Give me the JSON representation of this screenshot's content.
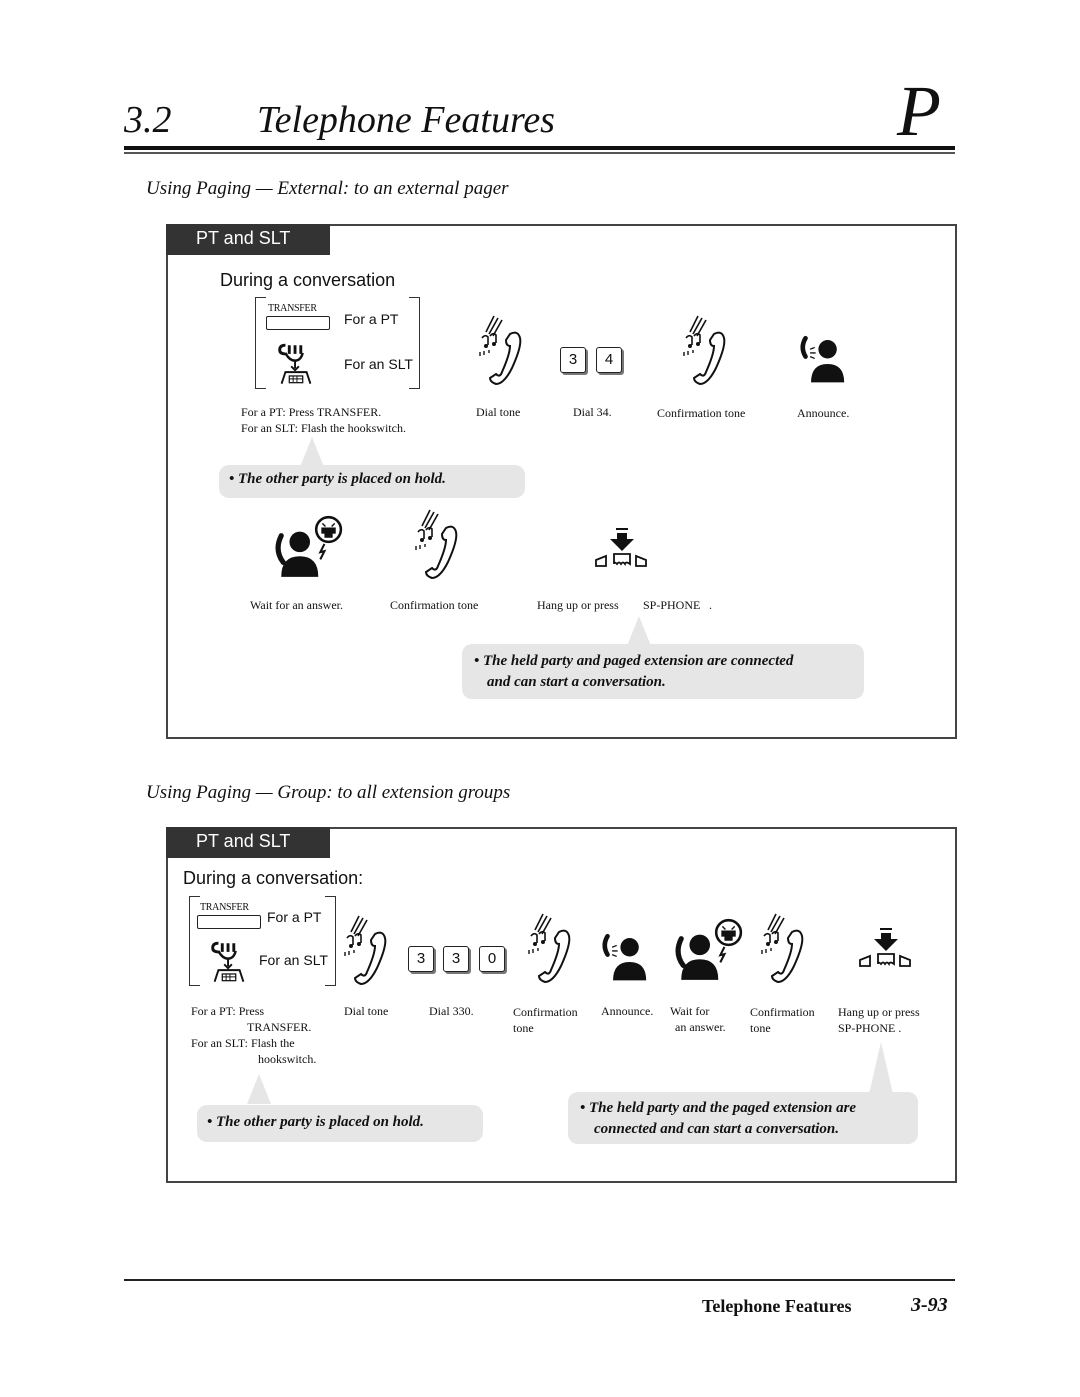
{
  "header": {
    "section_number": "3.2",
    "section_title": "Telephone Features",
    "tab_letter": "P"
  },
  "external": {
    "title": "Using Paging — External: to an external pager",
    "tab_label": "PT and SLT",
    "heading": "During a conversation",
    "transfer_button_label": "TRANSFER",
    "for_pt": "For a PT",
    "for_slt": "For an SLT",
    "step_captions": {
      "transfer_line1": "For a PT: Press TRANSFER.",
      "transfer_line2": "For an SLT: Flash the hookswitch.",
      "dial_tone": "Dial tone",
      "dial": "Dial 34.",
      "confirmation": "Confirmation tone",
      "announce": "Announce.",
      "wait": "Wait for an answer.",
      "confirmation2": "Confirmation tone",
      "hangup": "Hang up or press",
      "sp_phone": "SP-PHONE",
      "period": "."
    },
    "keys": [
      "3",
      "4"
    ],
    "note_hold": "The other party is placed on hold.",
    "note_connected_line1": "The held party and paged extension are connected",
    "note_connected_line2": "and can start a conversation."
  },
  "group": {
    "title": "Using Paging — Group: to all extension groups",
    "tab_label": "PT and SLT",
    "heading": "During a conversation:",
    "transfer_button_label": "TRANSFER",
    "for_pt": "For a PT",
    "for_slt": "For an SLT",
    "captions": {
      "transfer_l1": "For a PT: Press",
      "transfer_l2": "TRANSFER.",
      "transfer_l3": "For an SLT: Flash the",
      "transfer_l4": "hookswitch.",
      "dial_tone": "Dial tone",
      "dial": "Dial 330.",
      "confirmation_l1": "Confirmation",
      "confirmation_l2": "tone",
      "announce": "Announce.",
      "wait_l1": "Wait for",
      "wait_l2": "an answer.",
      "confirmation2_l1": "Confirmation",
      "confirmation2_l2": "tone",
      "hangup_l1": "Hang up or press",
      "hangup_l2": "SP-PHONE ."
    },
    "keys": [
      "3",
      "3",
      "0"
    ],
    "note_hold": "The other party is placed on hold.",
    "note_connected_line1": "The held party and the paged extension are",
    "note_connected_line2": "connected and can start a conversation."
  },
  "footer": {
    "title": "Telephone Features",
    "page_number": "3-93"
  }
}
